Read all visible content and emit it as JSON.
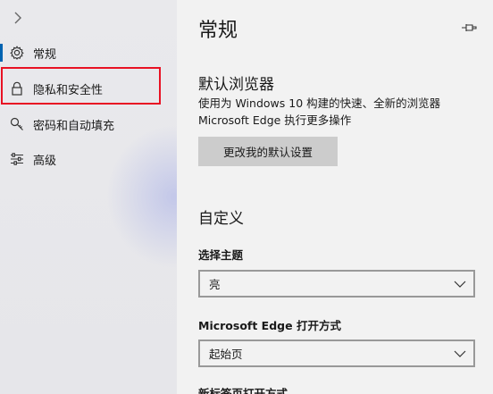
{
  "sidebar": {
    "items": [
      {
        "label": "常规",
        "icon": "gear-icon",
        "active": true
      },
      {
        "label": "隐私和安全性",
        "icon": "lock-icon",
        "active": false
      },
      {
        "label": "密码和自动填充",
        "icon": "key-icon",
        "active": false
      },
      {
        "label": "高级",
        "icon": "sliders-icon",
        "active": false
      }
    ]
  },
  "main": {
    "title": "常规",
    "default_browser": {
      "heading": "默认浏览器",
      "desc_line1": "使用为 Windows 10 构建的快速、全新的浏览器",
      "desc_line2": "Microsoft Edge 执行更多操作",
      "button_label": "更改我的默认设置"
    },
    "customize": {
      "heading": "自定义",
      "theme_label": "选择主题",
      "theme_value": "亮",
      "open_with_label": "Microsoft Edge 打开方式",
      "open_with_value": "起始页",
      "new_tab_label": "新标签页打开方式"
    }
  },
  "colors": {
    "accent": "#0063b1",
    "highlight": "#e81123"
  }
}
